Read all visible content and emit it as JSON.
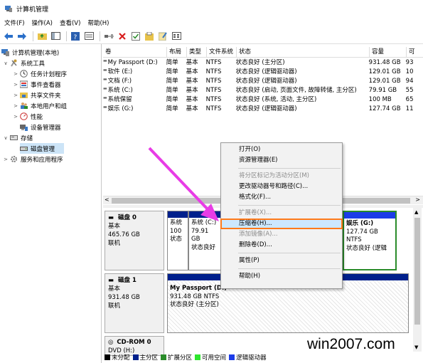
{
  "window": {
    "title": "计算机管理"
  },
  "menubar": [
    "文件(F)",
    "操作(A)",
    "查看(V)",
    "帮助(H)"
  ],
  "tree": [
    {
      "label": "计算机管理(本地)",
      "level": 0,
      "arrow": "",
      "icon": "computer-icon"
    },
    {
      "label": "系统工具",
      "level": 1,
      "arrow": "∨",
      "icon": "tools-icon"
    },
    {
      "label": "任务计划程序",
      "level": 2,
      "arrow": ">",
      "icon": "clock-icon"
    },
    {
      "label": "事件查看器",
      "level": 2,
      "arrow": ">",
      "icon": "event-icon"
    },
    {
      "label": "共享文件夹",
      "level": 2,
      "arrow": ">",
      "icon": "folder-icon"
    },
    {
      "label": "本地用户和组",
      "level": 2,
      "arrow": ">",
      "icon": "users-icon"
    },
    {
      "label": "性能",
      "level": 2,
      "arrow": ">",
      "icon": "performance-icon"
    },
    {
      "label": "设备管理器",
      "level": 2,
      "arrow": "",
      "icon": "device-icon"
    },
    {
      "label": "存储",
      "level": 1,
      "arrow": "∨",
      "icon": "storage-icon"
    },
    {
      "label": "磁盘管理",
      "level": 2,
      "arrow": "",
      "icon": "disk-icon",
      "selected": true
    },
    {
      "label": "服务和应用程序",
      "level": 1,
      "arrow": ">",
      "icon": "services-icon"
    }
  ],
  "table": {
    "headers": [
      "卷",
      "布局",
      "类型",
      "文件系统",
      "状态",
      "容量",
      "可"
    ],
    "rows": [
      [
        "My Passport (D:)",
        "简单",
        "基本",
        "NTFS",
        "状态良好 (主分区)",
        "931.48 GB",
        "93"
      ],
      [
        "软件 (E:)",
        "简单",
        "基本",
        "NTFS",
        "状态良好 (逻辑驱动器)",
        "129.01 GB",
        "10"
      ],
      [
        "文档 (F:)",
        "简单",
        "基本",
        "NTFS",
        "状态良好 (逻辑驱动器)",
        "129.01 GB",
        "94"
      ],
      [
        "系统 (C:)",
        "简单",
        "基本",
        "NTFS",
        "状态良好 (启动, 页面文件, 故障转储, 主分区)",
        "79.91 GB",
        "55"
      ],
      [
        "系统保留",
        "简单",
        "基本",
        "NTFS",
        "状态良好 (系统, 活动, 主分区)",
        "100 MB",
        "65"
      ],
      [
        "娱乐 (G:)",
        "简单",
        "基本",
        "NTFS",
        "状态良好 (逻辑驱动器)",
        "127.74 GB",
        "11"
      ]
    ]
  },
  "disks": [
    {
      "name": "磁盘 0",
      "type": "基本",
      "size": "465.76 GB",
      "status": "联机"
    },
    {
      "name": "磁盘 1",
      "type": "基本",
      "size": "931.48 GB",
      "status": "联机"
    },
    {
      "name": "CD-ROM 0",
      "type": "DVD (H:)",
      "size": "",
      "status": ""
    }
  ],
  "partitions": {
    "d0p1": {
      "line1": "系统",
      "line2": "100",
      "line3": "状态"
    },
    "d0p2": {
      "line1": "系统 (C:)",
      "line2": "79.91 GB",
      "line3": "状态良好"
    },
    "d0p3": {
      "line1": "娱乐 (G:)",
      "line2": "127.74 GB NTFS",
      "line3": "状态良好 (逻辑"
    },
    "d1p1": {
      "line1": "My Passport (D:)",
      "line2": "931.48 GB NTFS",
      "line3": "状态良好 (主分区)"
    }
  },
  "legend": [
    {
      "label": "未分配",
      "color": "#000000"
    },
    {
      "label": "主分区",
      "color": "#00208c"
    },
    {
      "label": "扩展分区",
      "color": "#2a8c2a"
    },
    {
      "label": "可用空间",
      "color": "#2ee62e"
    },
    {
      "label": "逻辑驱动器",
      "color": "#1c3ce8"
    }
  ],
  "context_menu": [
    {
      "label": "打开(O)",
      "enabled": true
    },
    {
      "label": "资源管理器(E)",
      "enabled": true
    },
    {
      "sep": true
    },
    {
      "label": "将分区标记为活动分区(M)",
      "enabled": false
    },
    {
      "label": "更改驱动器号和路径(C)...",
      "enabled": true
    },
    {
      "label": "格式化(F)...",
      "enabled": true
    },
    {
      "sep": true
    },
    {
      "label": "扩展卷(X)...",
      "enabled": false
    },
    {
      "label": "压缩卷(H)...",
      "enabled": true,
      "highlighted": true
    },
    {
      "label": "添加镜像(A)...",
      "enabled": false
    },
    {
      "label": "删除卷(D)...",
      "enabled": true
    },
    {
      "sep": true
    },
    {
      "label": "属性(P)",
      "enabled": true
    },
    {
      "sep": true
    },
    {
      "label": "帮助(H)",
      "enabled": true
    }
  ],
  "watermark": "win2007.com",
  "colors": {
    "accent_arrow": "#e83ce6",
    "highlight_border": "#ff7a1a",
    "primary_partition": "#00208c"
  }
}
